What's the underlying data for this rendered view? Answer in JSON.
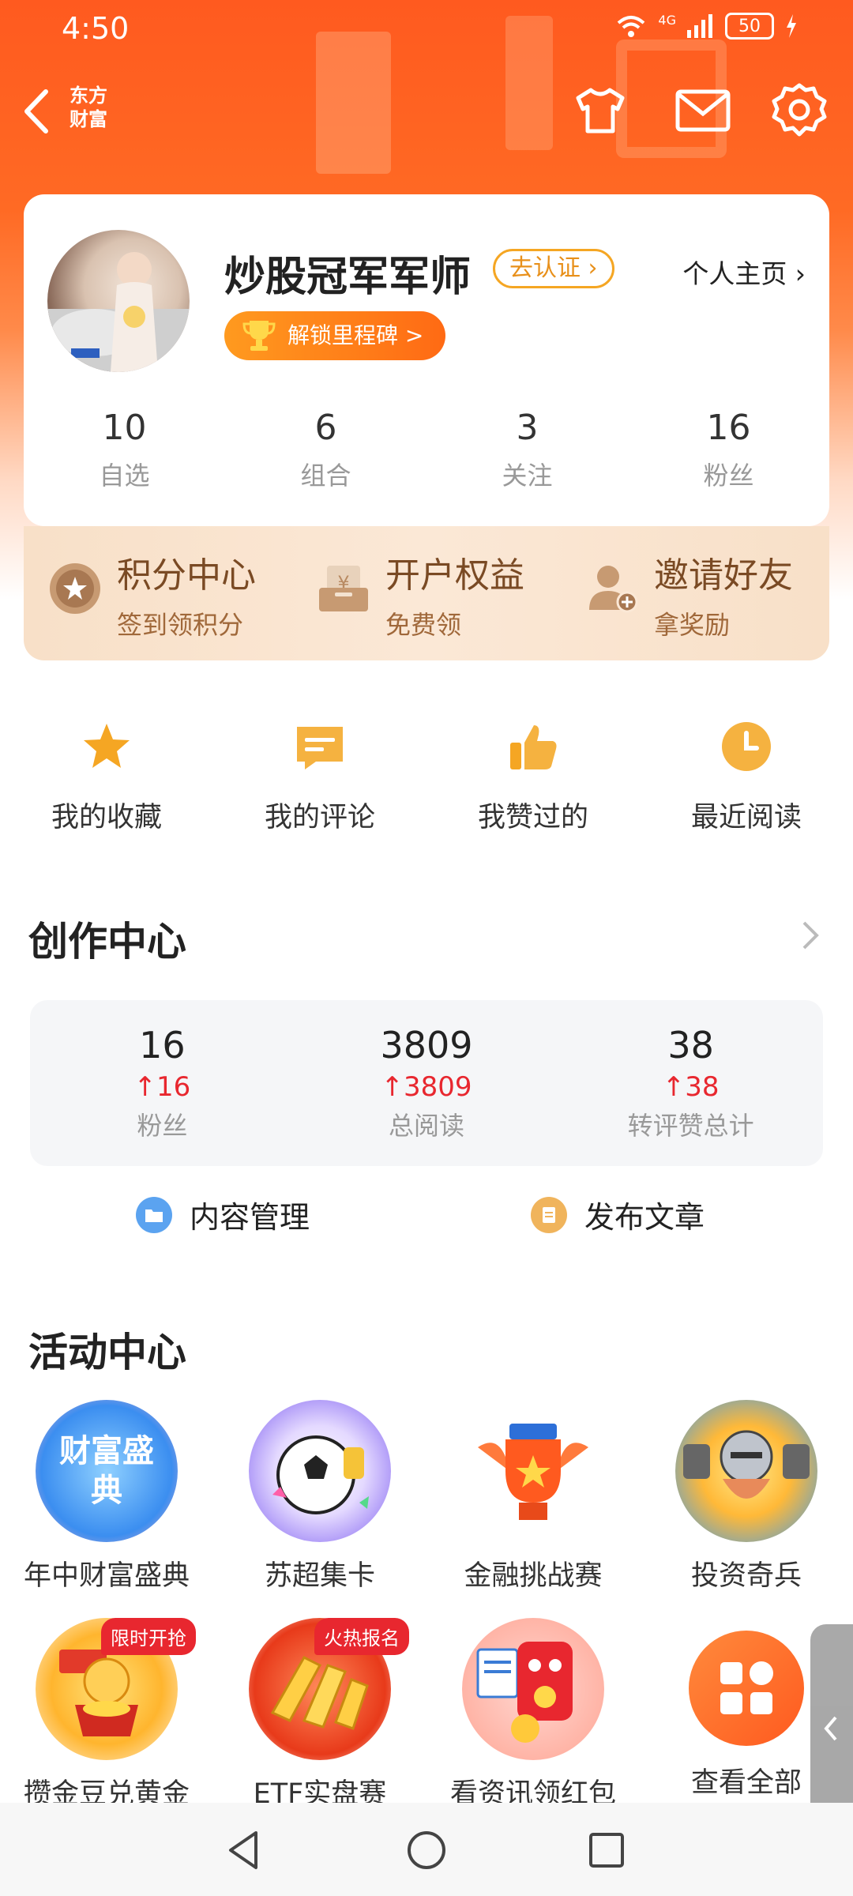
{
  "status_bar": {
    "time": "4:50",
    "network": "4G",
    "battery": "50"
  },
  "top_bar": {
    "logo_line1": "东方",
    "logo_line2": "财富"
  },
  "profile": {
    "name": "炒股冠军军师",
    "verify_label": "去认证 ›",
    "homepage_label": "个人主页 ›",
    "milestone_label": "解锁里程碑 >",
    "stats": [
      {
        "value": "10",
        "label": "自选"
      },
      {
        "value": "6",
        "label": "组合"
      },
      {
        "value": "3",
        "label": "关注"
      },
      {
        "value": "16",
        "label": "粉丝"
      }
    ]
  },
  "perks": [
    {
      "title": "积分中心",
      "subtitle": "签到领积分",
      "icon": "star-coin-icon"
    },
    {
      "title": "开户权益",
      "subtitle": "免费领",
      "icon": "yen-box-icon"
    },
    {
      "title": "邀请好友",
      "subtitle": "拿奖励",
      "icon": "add-user-icon"
    }
  ],
  "quick_links": [
    {
      "label": "我的收藏",
      "icon": "star-icon"
    },
    {
      "label": "我的评论",
      "icon": "comment-icon"
    },
    {
      "label": "我赞过的",
      "icon": "thumbs-up-icon"
    },
    {
      "label": "最近阅读",
      "icon": "clock-icon"
    }
  ],
  "creation_center": {
    "title": "创作中心",
    "stats": [
      {
        "value": "16",
        "delta": "↑16",
        "label": "粉丝"
      },
      {
        "value": "3809",
        "delta": "↑3809",
        "label": "总阅读"
      },
      {
        "value": "38",
        "delta": "↑38",
        "label": "转评赞总计"
      }
    ],
    "content_manage": "内容管理",
    "publish_article": "发布文章"
  },
  "activity_center": {
    "title": "活动中心",
    "row1": [
      {
        "label": "年中财富盛典",
        "badge_text": "财富盛典"
      },
      {
        "label": "苏超集卡"
      },
      {
        "label": "金融挑战赛"
      },
      {
        "label": "投资奇兵"
      }
    ],
    "row2": [
      {
        "label": "攒金豆兑黄金",
        "tag": "限时开抢"
      },
      {
        "label": "ETF实盘赛",
        "tag": "火热报名"
      },
      {
        "label": "看资讯领红包"
      },
      {
        "label": "查看全部"
      }
    ]
  },
  "colors": {
    "brand": "#ff5a1f",
    "accent": "#f5a623",
    "up": "#e8272f"
  }
}
